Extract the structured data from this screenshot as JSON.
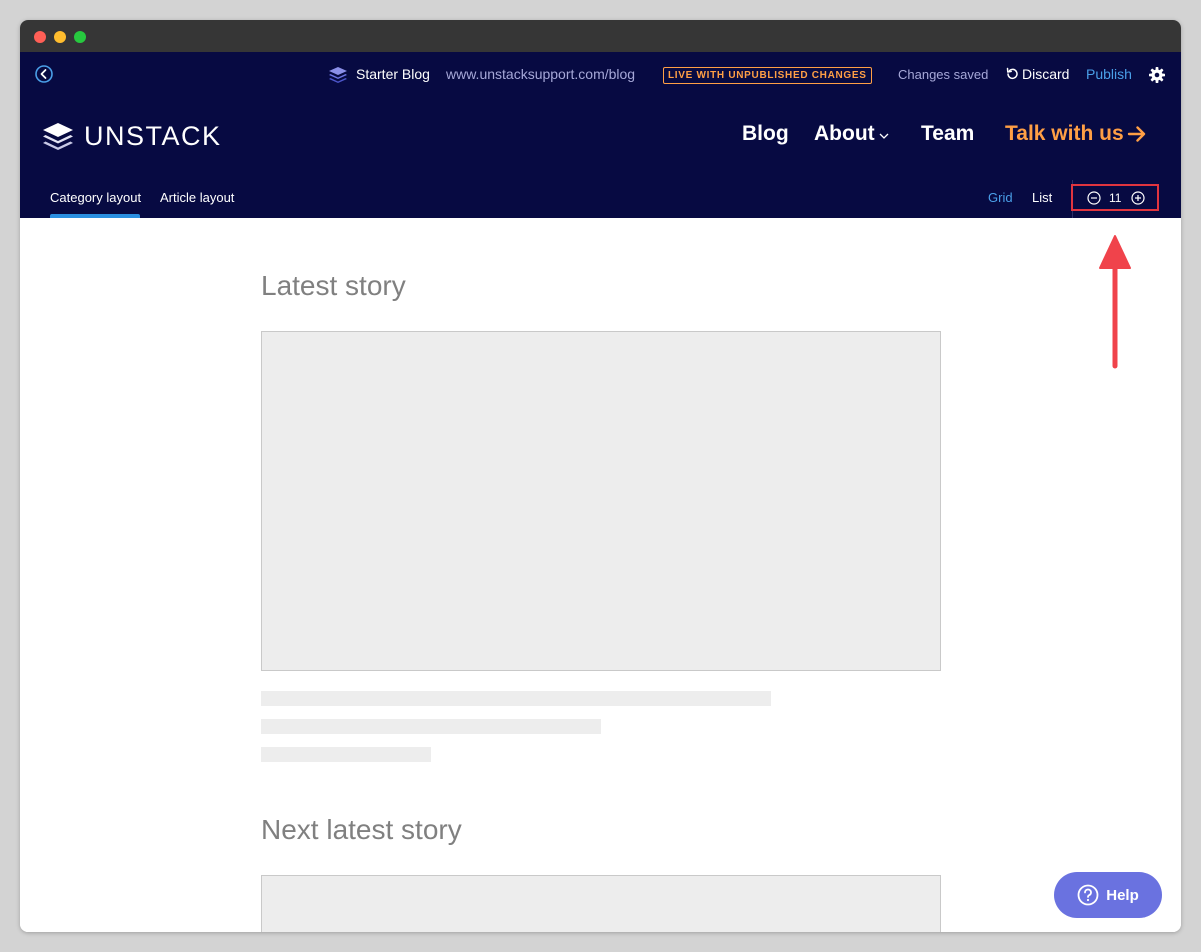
{
  "editor_bar": {
    "site_name": "Starter Blog",
    "site_url": "www.unstacksupport.com/blog",
    "status_badge": "LIVE WITH UNPUBLISHED CHANGES",
    "save_status": "Changes saved",
    "discard_label": "Discard",
    "publish_label": "Publish"
  },
  "header": {
    "brand": "UNSTACK",
    "nav": {
      "blog": "Blog",
      "about": "About",
      "team": "Team",
      "cta": "Talk with us"
    }
  },
  "layout_bar": {
    "tabs": [
      "Category layout",
      "Article layout"
    ],
    "active_tab": "Category layout",
    "views": {
      "grid": "Grid",
      "list": "List"
    },
    "active_view": "Grid",
    "item_count": "11"
  },
  "content": {
    "section_1_title": "Latest story",
    "section_2_title": "Next latest story"
  },
  "help": {
    "label": "Help"
  },
  "colors": {
    "navy": "#070a42",
    "accent_orange": "#ff9f45",
    "link_blue": "#4a9fe8",
    "highlight_red": "#e0353f",
    "help_purple": "#6a72e0"
  }
}
